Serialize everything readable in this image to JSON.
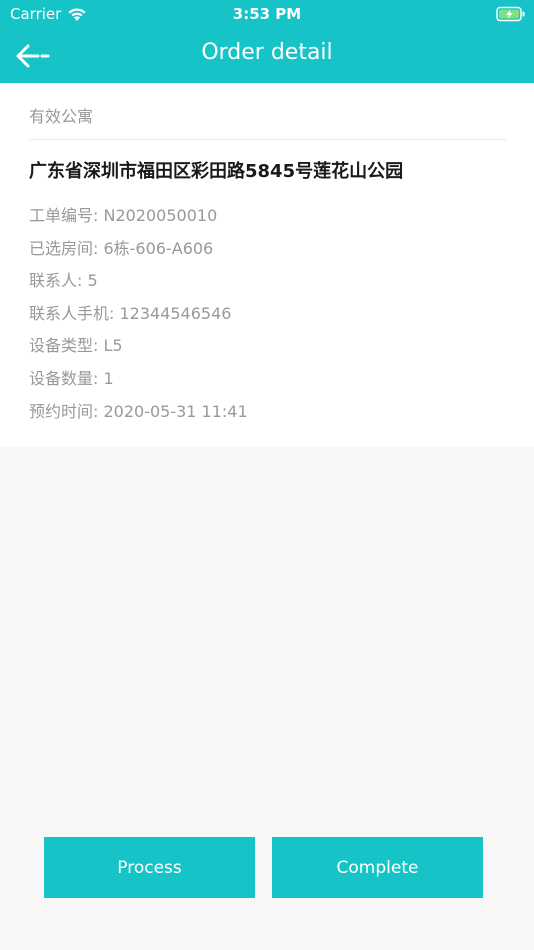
{
  "status_bar": {
    "carrier": "Carrier",
    "time": "3:53 PM"
  },
  "nav": {
    "title": "Order detail",
    "back_icon": "back-arrow-icon"
  },
  "order": {
    "apartment": "有效公寓",
    "address": "广东省深圳市福田区彩田路5845号莲花山公园",
    "details": [
      "工单编号: N2020050010",
      "已选房间:  6栋-606-A606",
      "联系人: 5",
      "联系人手机: 12344546546",
      "设备类型: L5",
      "设备数量: 1",
      "预约时间: 2020-05-31 11:41"
    ]
  },
  "actions": {
    "process_label": "Process",
    "complete_label": "Complete"
  },
  "colors": {
    "accent": "#16c4c8",
    "background": "#f7f7f7",
    "card": "#ffffff",
    "secondary_text": "#999999",
    "primary_text": "#1a1a1a"
  }
}
